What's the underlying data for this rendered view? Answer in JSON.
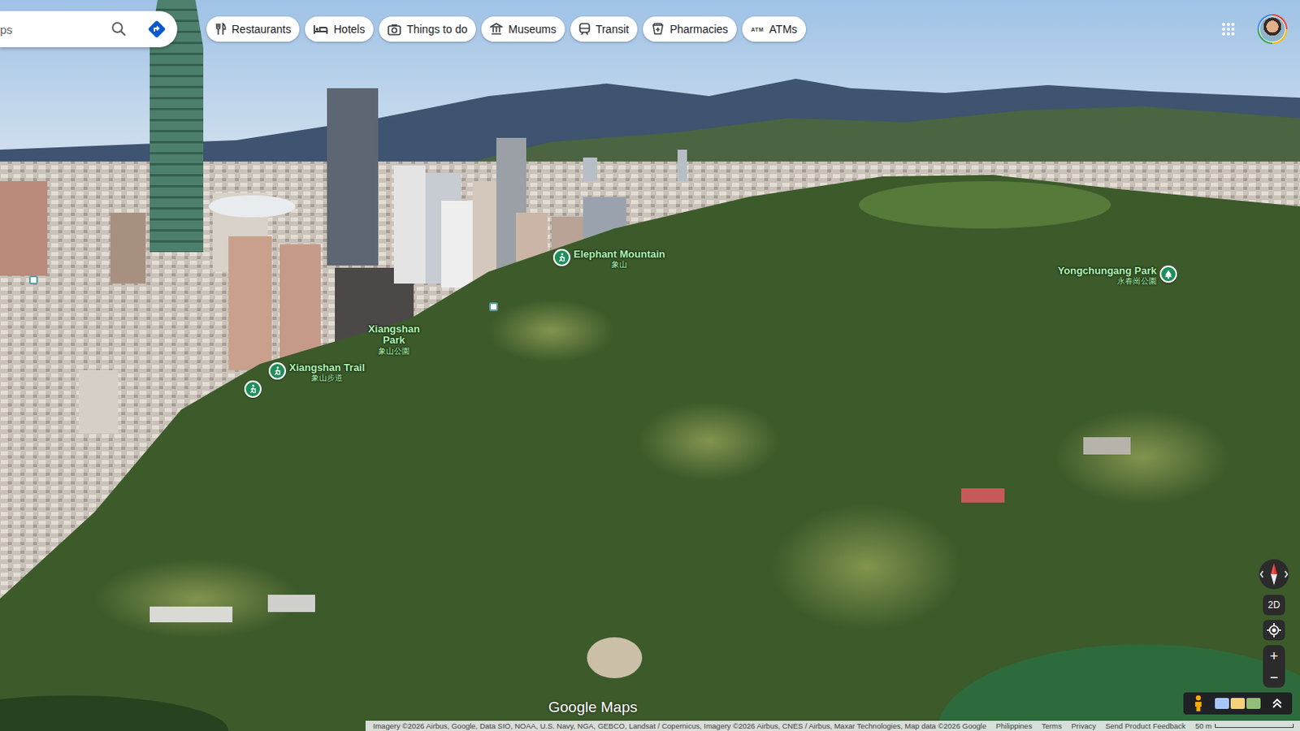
{
  "search": {
    "placeholder": "ps"
  },
  "chips": [
    {
      "label": "Restaurants",
      "kind": "restaurant"
    },
    {
      "label": "Hotels",
      "kind": "hotel"
    },
    {
      "label": "Things to do",
      "kind": "camera"
    },
    {
      "label": "Museums",
      "kind": "museum"
    },
    {
      "label": "Transit",
      "kind": "transit"
    },
    {
      "label": "Pharmacies",
      "kind": "pharmacy"
    },
    {
      "label": "ATMs",
      "kind": "atm",
      "icon_text": "ATM"
    }
  ],
  "pins": [
    {
      "name": "Elephant Mountain",
      "native": "象山",
      "kind": "trail"
    },
    {
      "name": "Xiangshan Park",
      "native": "象山公園",
      "kind": "label"
    },
    {
      "name": "Xiangshan Trail",
      "native": "象山步道",
      "kind": "trail"
    },
    {
      "kind": "trail"
    },
    {
      "name": "Yongchungang Park",
      "native": "永春崗公園",
      "kind": "park"
    }
  ],
  "controls": {
    "view_toggle": "2D",
    "zoom_in": "+",
    "zoom_out": "−"
  },
  "watermark": "Google Maps",
  "footer": {
    "attribution": "Imagery ©2026 Airbus, Google, Data SIO, NOAA, U.S. Navy, NGA, GEBCO, Landsat / Copernicus, Imagery ©2026 Airbus, CNES / Airbus, Maxar Technologies, Map data ©2026 Google",
    "links": [
      "Philippines",
      "Terms",
      "Privacy",
      "Send Product Feedback"
    ],
    "scale": "50 m"
  }
}
